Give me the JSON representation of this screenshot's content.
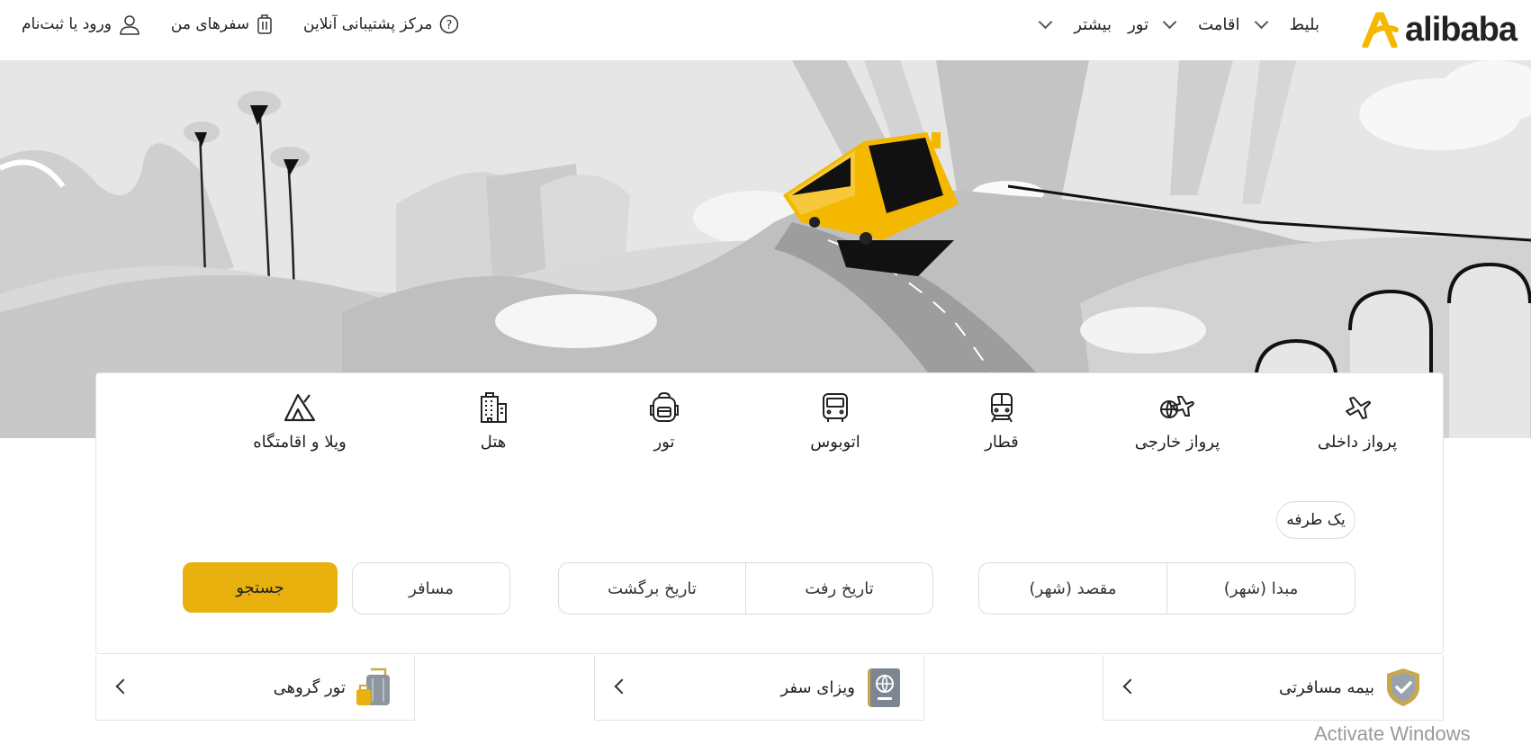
{
  "brand": {
    "name": "alibaba",
    "accent": "#f5b800"
  },
  "nav": {
    "items": [
      {
        "label": "بلیط",
        "dropdown": true
      },
      {
        "label": "اقامت",
        "dropdown": true
      },
      {
        "label": "تور",
        "dropdown": false
      },
      {
        "label": "بیشتر",
        "dropdown": true
      }
    ],
    "support": "مرکز پشتیبانی آنلاین",
    "my_trips": "سفرهای من",
    "login": "ورود یا ثبت‌نام"
  },
  "tabs": [
    {
      "label": "پرواز داخلی",
      "icon": "plane-icon"
    },
    {
      "label": "پرواز خارجی",
      "icon": "globe-plane-icon"
    },
    {
      "label": "قطار",
      "icon": "train-icon"
    },
    {
      "label": "اتوبوس",
      "icon": "bus-icon"
    },
    {
      "label": "تور",
      "icon": "backpack-icon"
    },
    {
      "label": "هتل",
      "icon": "building-icon"
    },
    {
      "label": "ویلا و اقامتگاه",
      "icon": "tent-icon"
    }
  ],
  "search": {
    "trip_type": "یک طرفه",
    "origin": "مبدا (شهر)",
    "destination": "مقصد (شهر)",
    "depart": "تاریخ رفت",
    "return": "تاریخ برگشت",
    "passenger": "مسافر",
    "submit": "جستجو",
    "button_color": "#e8b10e"
  },
  "services": [
    {
      "label": "بیمه مسافرتی",
      "icon": "shield-icon"
    },
    {
      "label": "ویزای سفر",
      "icon": "passport-icon"
    },
    {
      "label": "تور گروهی",
      "icon": "luggage-icon"
    }
  ],
  "watermark": "Activate Windows"
}
